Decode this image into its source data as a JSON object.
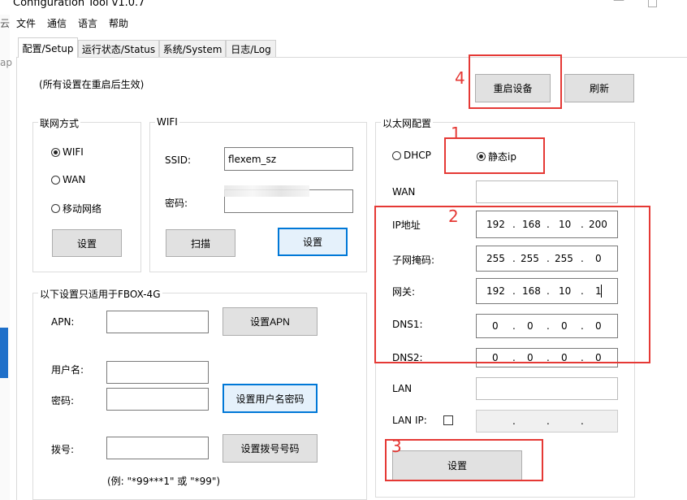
{
  "window": {
    "title": "Configuration Tool v1.0.7",
    "left_strip_text": "云",
    "left_strip_text2": "ap"
  },
  "menu": [
    {
      "label": "文件"
    },
    {
      "label": "通信"
    },
    {
      "label": "语言"
    },
    {
      "label": "帮助"
    }
  ],
  "tabs": [
    {
      "label": "配置/Setup",
      "active": true
    },
    {
      "label": "运行状态/Status"
    },
    {
      "label": "系统/System"
    },
    {
      "label": "日志/Log"
    }
  ],
  "notice": "(所有设置在重启后生效)",
  "buttons": {
    "reboot": "重启设备",
    "refresh": "刷新"
  },
  "network_mode": {
    "title": "联网方式",
    "options": [
      {
        "label": "WIFI",
        "selected": true
      },
      {
        "label": "WAN",
        "selected": false
      },
      {
        "label": "移动网络",
        "selected": false
      }
    ],
    "set_button": "设置"
  },
  "wifi": {
    "title": "WIFI",
    "ssid_label": "SSID:",
    "ssid_value": "flexem_sz",
    "password_label": "密码:",
    "password_value": "",
    "scan_button": "扫描",
    "set_button": "设置"
  },
  "fbox4g": {
    "title": "以下设置只适用于FBOX-4G",
    "apn_label": "APN:",
    "apn_button": "设置APN",
    "username_label": "用户名:",
    "password_label": "密码:",
    "userpass_button": "设置用户名密码",
    "dial_label": "拨号:",
    "dial_button": "设置拨号号码",
    "example": "(例: \"*99***1\" 或 \"*99\")"
  },
  "ethernet": {
    "title": "以太网配置",
    "dhcp_label": "DHCP",
    "static_label": "静态ip",
    "static_selected": true,
    "wan_label": "WAN",
    "ip_label": "IP地址",
    "ip": [
      "192",
      "168",
      "10",
      "200"
    ],
    "mask_label": "子网掩码:",
    "mask": [
      "255",
      "255",
      "255",
      "0"
    ],
    "gateway_label": "网关:",
    "gateway": [
      "192",
      "168",
      "10",
      "1"
    ],
    "dns1_label": "DNS1:",
    "dns1": [
      "0",
      "0",
      "0",
      "0"
    ],
    "dns2_label": "DNS2:",
    "dns2": [
      "0",
      "0",
      "0",
      "0"
    ],
    "lan_label": "LAN",
    "lanip_label": "LAN IP:",
    "lanip": [
      "",
      "",
      "",
      ""
    ],
    "set_button": "设置"
  },
  "annotations": [
    {
      "label": "1"
    },
    {
      "label": "2"
    },
    {
      "label": "3"
    },
    {
      "label": "4"
    }
  ],
  "colors": {
    "annotation": "#e53935",
    "focus": "#0078d7"
  }
}
